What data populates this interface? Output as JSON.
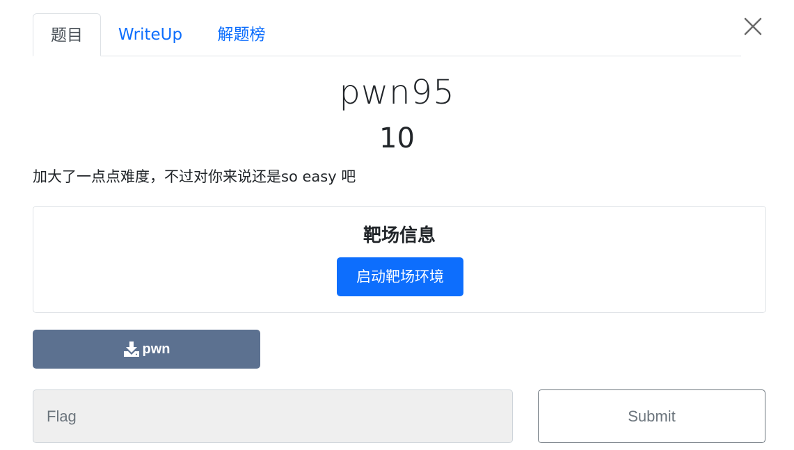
{
  "tabs": [
    {
      "label": "题目",
      "active": true
    },
    {
      "label": "WriteUp",
      "active": false
    },
    {
      "label": "解题榜",
      "active": false
    }
  ],
  "challenge": {
    "name": "pwn95",
    "points": "10",
    "description": "加大了一点点难度，不过对你来说还是so easy 吧"
  },
  "range": {
    "title": "靶场信息",
    "start_label": "启动靶场环境"
  },
  "download": {
    "icon": "download-icon",
    "label": "pwn"
  },
  "flag": {
    "value": "",
    "placeholder": "Flag"
  },
  "submit_label": "Submit",
  "colors": {
    "primary": "#0d6efd",
    "download_bg": "#5c7190",
    "input_bg": "#efefef",
    "muted": "#6c757d"
  }
}
